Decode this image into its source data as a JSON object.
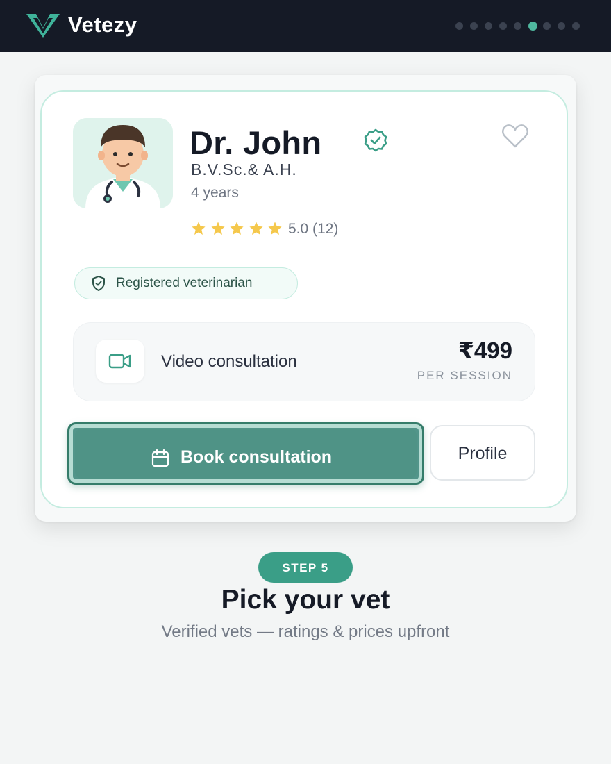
{
  "header": {
    "brand": "Vetezy",
    "progress": {
      "total_steps": 9,
      "current_step": 6
    },
    "colors": {
      "background": "#151a26",
      "accent": "#4fb89f"
    }
  },
  "vet_card": {
    "name": "Dr. John",
    "degree": "B.V.Sc.& A.H.",
    "experience": "4 years",
    "rating": {
      "stars": 5,
      "text": "5.0 (12)"
    },
    "verified_icon": "verified-check-icon",
    "favorite_icon": "heart-outline-icon",
    "badge": {
      "icon": "shield-check-icon",
      "text": "Registered veterinarian"
    },
    "consultation": {
      "icon": "video-camera-icon",
      "label": "Video consultation",
      "price": "₹499",
      "price_unit": "PER SESSION"
    },
    "actions": {
      "book": {
        "icon": "calendar-icon",
        "label": "Book consultation"
      },
      "profile": {
        "label": "Profile"
      }
    },
    "colors": {
      "primary": "#4f9386",
      "star": "#f5c84c",
      "badge_border": "#c4ece0"
    }
  },
  "step": {
    "label": "STEP 5",
    "title": "Pick your vet",
    "subtitle": "Verified vets — ratings & prices upfront"
  }
}
